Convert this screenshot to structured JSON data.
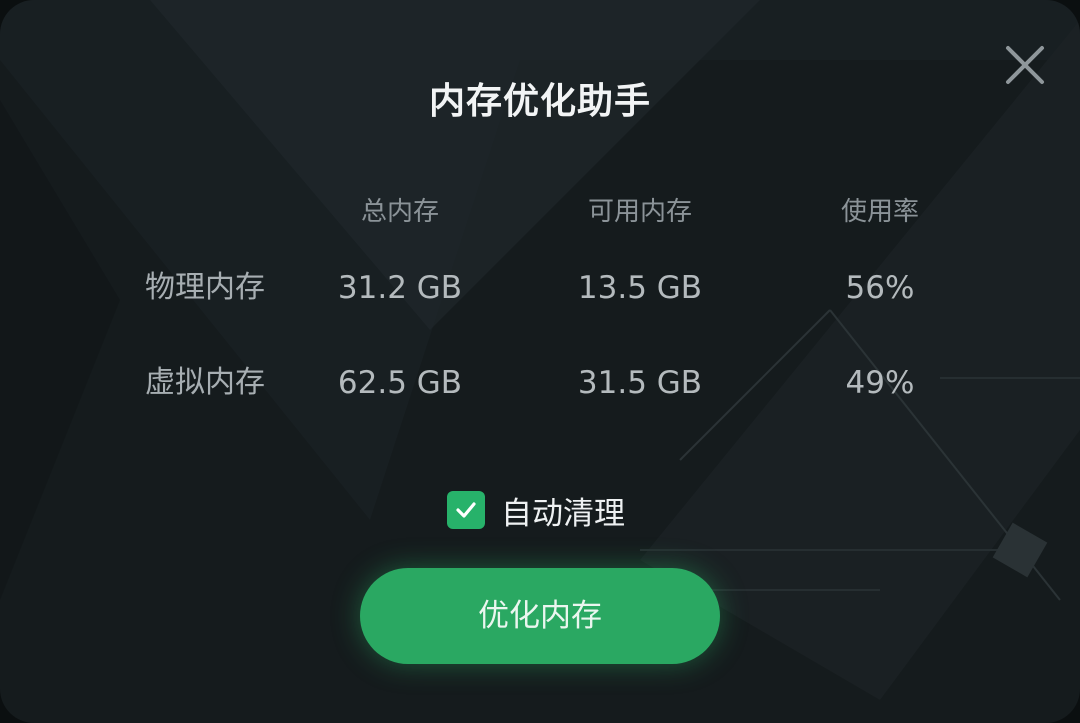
{
  "dialog": {
    "title": "内存优化助手"
  },
  "table": {
    "headers": [
      "总内存",
      "可用内存",
      "使用率"
    ],
    "rows": [
      {
        "label": "物理内存",
        "total": "31.2 GB",
        "available": "13.5 GB",
        "usage": "56%"
      },
      {
        "label": "虚拟内存",
        "total": "62.5 GB",
        "available": "31.5 GB",
        "usage": "49%"
      }
    ]
  },
  "options": {
    "auto_clean_label": "自动清理",
    "auto_clean_checked": true
  },
  "actions": {
    "optimize_label": "优化内存"
  },
  "colors": {
    "accent": "#2aa862",
    "background": "#151b1d"
  },
  "icons": {
    "close": "close-icon",
    "check": "checkmark-icon"
  }
}
